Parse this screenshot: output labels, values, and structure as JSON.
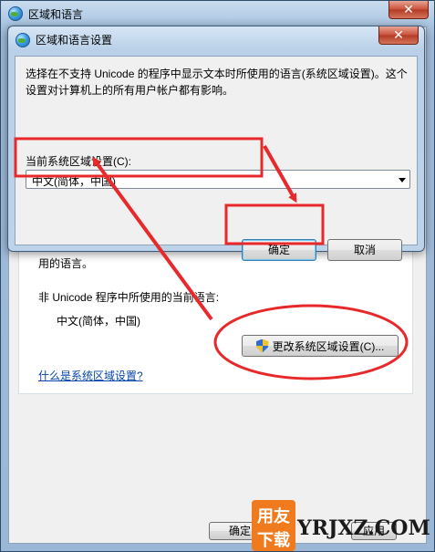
{
  "outer_window": {
    "title": "区域和语言",
    "panel": {
      "line_tail": "用的语言。",
      "current_label": "非 Unicode 程序中所使用的当前语言:",
      "current_value": "中文(简体，中国)",
      "change_button": "更改系统区域设置(C)...",
      "help_link": "什么是系统区域设置?"
    },
    "ok_button": "确定",
    "apply_partial": "应用"
  },
  "dialog": {
    "title": "区域和语言设置",
    "description": "选择在不支持 Unicode 的程序中显示文本时所使用的语言(系统区域设置)。这个设置对计算机上的所有用户帐户都有影响。",
    "current_label": "当前系统区域设置(C):",
    "selected_locale": "中文(简体，中国)",
    "ok_button": "确定",
    "cancel_button": "取消"
  },
  "watermark": {
    "logo_top": "用友",
    "logo_bottom": "下载",
    "site": "YRJXZ.COM"
  },
  "colors": {
    "annotation": "#e8292b",
    "watermark_orange": "#f07b1e"
  },
  "icons": [
    "globe-icon",
    "close-icon",
    "uac-shield-icon",
    "dropdown-arrow-icon"
  ]
}
